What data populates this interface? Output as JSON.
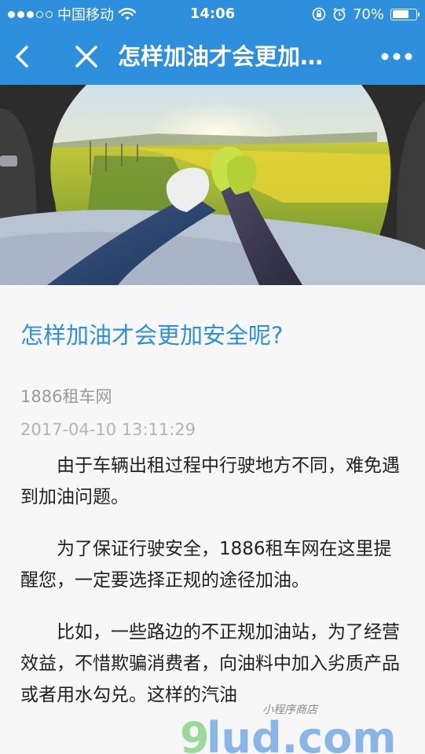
{
  "status_bar": {
    "carrier": "中国移动",
    "time": "14:06",
    "battery": "70%",
    "battery_level": 0.7,
    "signal_filled": 3,
    "signal_total": 5
  },
  "nav": {
    "title": "怎样加油才会更加…",
    "back_icon": "chevron-left-icon",
    "close_icon": "close-icon",
    "more_icon": "more-dots-icon"
  },
  "article": {
    "title": "怎样加油才会更加安全呢?",
    "source": "1886租车网",
    "date": "2017-04-10 13:11:29",
    "paragraphs": [
      "由于车辆出租过程中行驶地方不同，难免遇到加油问题。",
      "为了保证行驶安全，1886租车网在这里提醒您，一定要选择正规的途径加油。",
      "比如，一些路边的不正规加油站，为了经营效益，不惜欺骗消费者，向油料中加入劣质产品或者用水勾兑。这样的汽油"
    ]
  },
  "watermark": {
    "text": "小程序商店",
    "brand_green": "9",
    "brand_blue": "lud.com"
  },
  "colors": {
    "accent": "#2e8fdc",
    "background": "#f7f7f7"
  }
}
